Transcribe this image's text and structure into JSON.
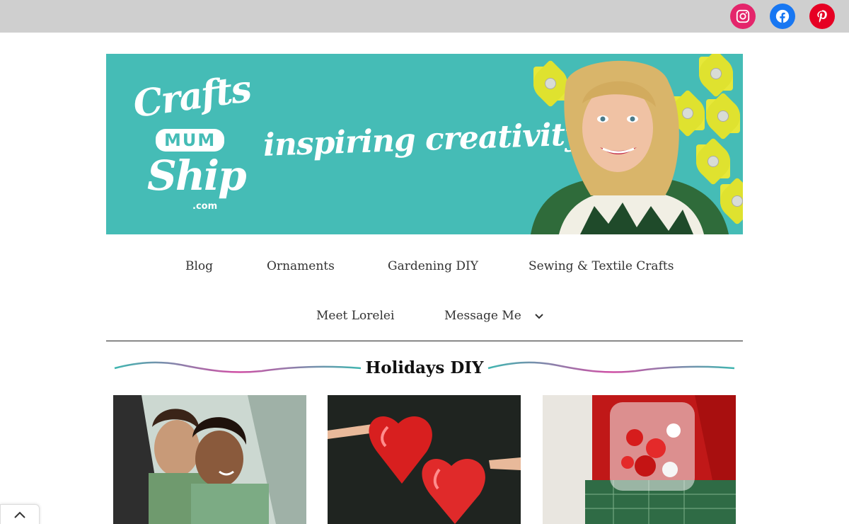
{
  "social": {
    "instagram": {
      "icon": "instagram-icon",
      "color": "#e4256b"
    },
    "facebook": {
      "icon": "facebook-icon",
      "color": "#1877f2"
    },
    "pinterest": {
      "icon": "pinterest-icon",
      "color": "#e60023"
    }
  },
  "banner": {
    "logo_line1": "Crafts",
    "logo_line2": "MUM",
    "logo_line3": "Ship",
    "logo_domain": ".com",
    "tagline": "inspiring creativity",
    "background": "#45bcb6"
  },
  "nav": {
    "items": [
      {
        "label": "Blog"
      },
      {
        "label": "Ornaments"
      },
      {
        "label": "Gardening DIY"
      },
      {
        "label": "Sewing & Textile Crafts"
      },
      {
        "label": "Meet Lorelei"
      },
      {
        "label": "Message Me"
      }
    ]
  },
  "section": {
    "title": "Holidays DIY"
  },
  "cards": [
    {
      "image": "girls-in-car-photo"
    },
    {
      "image": "heart-balloons-photo"
    },
    {
      "image": "red-jar-crafts-photo"
    }
  ],
  "back_to_top": {
    "icon": "chevron-up-icon"
  }
}
